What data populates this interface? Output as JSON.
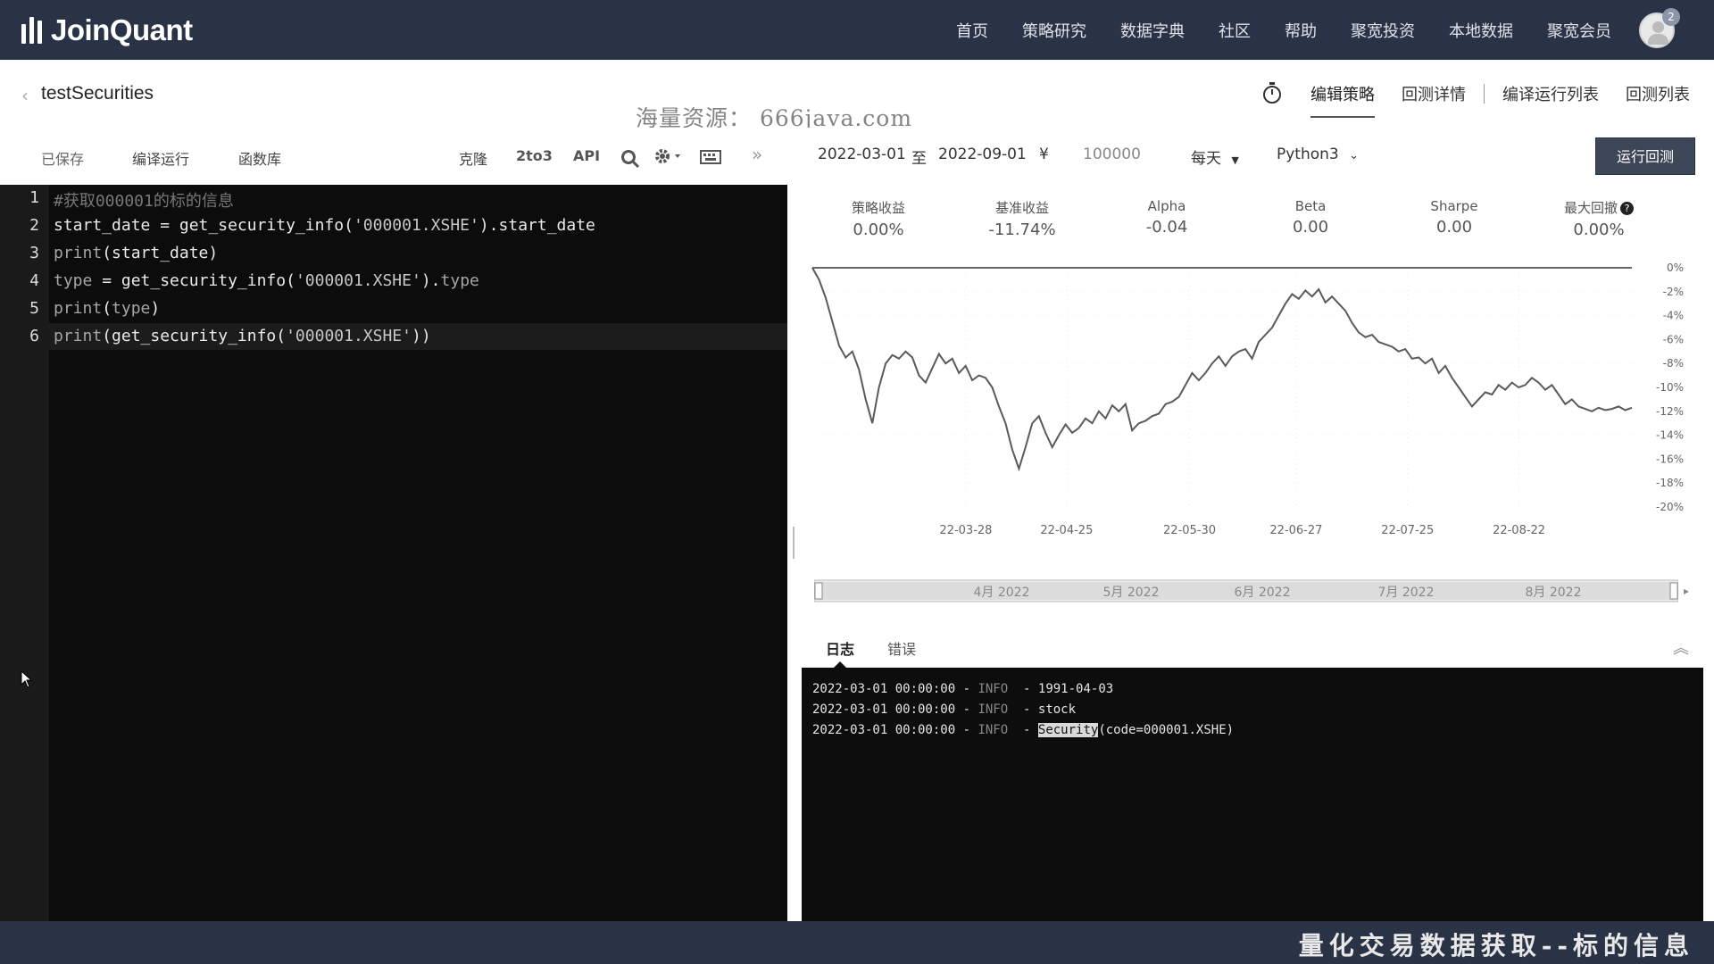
{
  "brand": {
    "name": "JoinQuant"
  },
  "nav": {
    "items": [
      "首页",
      "策略研究",
      "数据字典",
      "社区",
      "帮助",
      "聚宽投资",
      "本地数据",
      "聚宽会员"
    ],
    "badge": "2"
  },
  "strategy": {
    "name": "testSecurities"
  },
  "watermark": "海量资源： 666java.com",
  "right_tabs": [
    "编辑策略",
    "回测详情",
    "编译运行列表",
    "回测列表"
  ],
  "toolbar": {
    "saved": "已保存",
    "compile_run": "编译运行",
    "func_lib": "函数库",
    "clone": "克隆",
    "to3": "2to3",
    "api": "API"
  },
  "params": {
    "start_date": "2022-03-01",
    "to": "至",
    "end_date": "2022-09-01",
    "currency": "¥",
    "capital": "100000",
    "frequency": "每天",
    "language": "Python3",
    "run_backtest": "运行回测"
  },
  "editor": {
    "line_numbers": [
      "1",
      "2",
      "3",
      "4",
      "5",
      "6"
    ],
    "line1": "#获取000001的标的信息",
    "line2_a": "start_date = get_security_info(",
    "line2_b": "'000001.XSHE'",
    "line2_c": ").start_date",
    "line3_a": "print",
    "line3_b": "(start_date)",
    "line4_a": "type",
    "line4_b": " = get_security_info(",
    "line4_c": "'000001.XSHE'",
    "line4_d": ").",
    "line4_e": "type",
    "line5_a": "print",
    "line5_b": "(",
    "line5_c": "type",
    "line5_d": ")",
    "line6_a": "print",
    "line6_b": "(get_security_info(",
    "line6_c": "'000001.XSHE'",
    "line6_d": "))"
  },
  "stats": [
    {
      "label": "策略收益",
      "value": "0.00%"
    },
    {
      "label": "基准收益",
      "value": "-11.74%"
    },
    {
      "label": "Alpha",
      "value": "-0.04"
    },
    {
      "label": "Beta",
      "value": "0.00"
    },
    {
      "label": "Sharpe",
      "value": "0.00"
    },
    {
      "label": "最大回撤",
      "value": "0.00%"
    }
  ],
  "chart_data": {
    "type": "line",
    "x_ticks": [
      "22-03-28",
      "22-04-25",
      "22-05-30",
      "22-06-27",
      "22-07-25",
      "22-08-22"
    ],
    "y_ticks": [
      "0%",
      "-2%",
      "-4%",
      "-6%",
      "-8%",
      "-10%",
      "-12%",
      "-14%",
      "-16%",
      "-18%",
      "-20%"
    ],
    "ylim": [
      -20,
      0
    ],
    "series": [
      {
        "role": "strategy",
        "values": [
          0,
          0,
          0,
          0,
          0,
          0,
          0,
          0,
          0,
          0,
          0,
          0,
          0,
          0,
          0,
          0,
          0,
          0,
          0,
          0,
          0,
          0,
          0,
          0,
          0,
          0,
          0,
          0,
          0,
          0,
          0,
          0,
          0,
          0,
          0,
          0,
          0,
          0,
          0,
          0,
          0,
          0,
          0,
          0,
          0,
          0,
          0,
          0,
          0,
          0,
          0,
          0,
          0,
          0,
          0,
          0,
          0,
          0,
          0,
          0,
          0,
          0,
          0,
          0,
          0,
          0,
          0,
          0,
          0,
          0,
          0,
          0,
          0,
          0,
          0,
          0,
          0,
          0,
          0,
          0,
          0,
          0,
          0,
          0,
          0,
          0,
          0,
          0,
          0,
          0,
          0,
          0,
          0,
          0,
          0,
          0,
          0,
          0,
          0,
          0,
          0,
          0,
          0,
          0,
          0,
          0,
          0,
          0,
          0,
          0,
          0,
          0,
          0,
          0,
          0,
          0,
          0,
          0,
          0,
          0,
          0,
          0,
          0,
          0
        ]
      },
      {
        "role": "benchmark",
        "values": [
          0.0,
          -1.0,
          -2.5,
          -4.5,
          -6.5,
          -7.5,
          -7.0,
          -8.5,
          -11.0,
          -13.0,
          -10.0,
          -8.0,
          -7.3,
          -7.6,
          -7.0,
          -7.5,
          -9.0,
          -9.6,
          -8.4,
          -7.2,
          -8.0,
          -7.6,
          -8.8,
          -8.2,
          -9.4,
          -9.0,
          -9.2,
          -10.0,
          -11.6,
          -13.0,
          -15.2,
          -16.8,
          -15.0,
          -13.0,
          -12.4,
          -13.8,
          -15.0,
          -14.0,
          -13.1,
          -13.8,
          -13.4,
          -12.6,
          -13.0,
          -12.0,
          -12.6,
          -11.5,
          -12.0,
          -11.4,
          -13.6,
          -13.0,
          -12.8,
          -12.4,
          -12.2,
          -11.4,
          -11.2,
          -10.8,
          -9.8,
          -8.8,
          -9.4,
          -8.8,
          -8.0,
          -7.4,
          -8.2,
          -7.4,
          -7.0,
          -6.8,
          -7.6,
          -6.2,
          -5.6,
          -5.0,
          -4.0,
          -3.0,
          -2.2,
          -2.6,
          -1.9,
          -2.4,
          -1.8,
          -2.9,
          -2.4,
          -3.0,
          -3.6,
          -4.6,
          -5.4,
          -5.8,
          -5.6,
          -6.2,
          -6.4,
          -6.6,
          -7.0,
          -6.8,
          -7.6,
          -7.5,
          -8.0,
          -7.6,
          -8.8,
          -8.2,
          -9.2,
          -10.0,
          -10.8,
          -11.6,
          -11.0,
          -10.4,
          -10.6,
          -9.8,
          -10.2,
          -9.6,
          -10.0,
          -9.8,
          -9.2,
          -9.6,
          -10.2,
          -9.8,
          -10.6,
          -11.4,
          -11.0,
          -11.6,
          -11.8,
          -12.0,
          -11.7,
          -11.9,
          -11.8,
          -11.6,
          -11.9,
          -11.7
        ]
      }
    ]
  },
  "slider": {
    "months": [
      "4月 2022",
      "5月 2022",
      "6月 2022",
      "7月 2022",
      "8月 2022"
    ]
  },
  "log": {
    "tab_log": "日志",
    "tab_error": "错误",
    "lines": [
      {
        "ts": "2022-03-01 00:00:00",
        "sep": " - ",
        "level": "INFO",
        "dash": "  - ",
        "msg": "1991-04-03",
        "hl": "",
        "tail": ""
      },
      {
        "ts": "2022-03-01 00:00:00",
        "sep": " - ",
        "level": "INFO",
        "dash": "  - ",
        "msg": "stock",
        "hl": "",
        "tail": ""
      },
      {
        "ts": "2022-03-01 00:00:00",
        "sep": " - ",
        "level": "INFO",
        "dash": "  - ",
        "msg": "",
        "hl": "Security",
        "tail": "(code=000001.XSHE)"
      }
    ]
  },
  "caption": "量化交易数据获取--标的信息"
}
